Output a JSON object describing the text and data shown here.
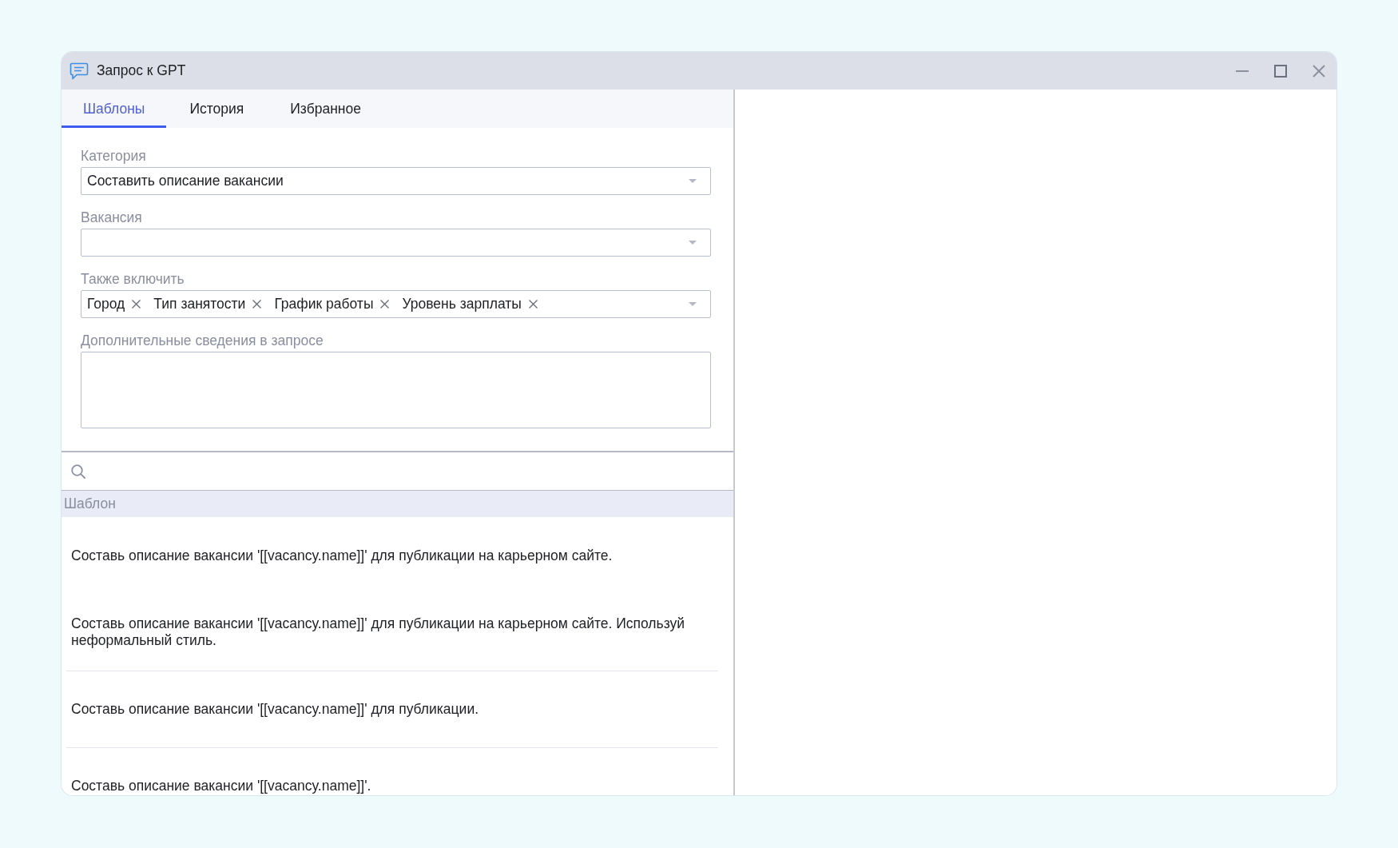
{
  "window": {
    "title": "Запрос к GPT"
  },
  "tabs": [
    {
      "label": "Шаблоны",
      "selected": true
    },
    {
      "label": "История",
      "selected": false
    },
    {
      "label": "Избранное",
      "selected": false
    }
  ],
  "form": {
    "fields": [
      {
        "kind": "select",
        "label": "Категория",
        "value": "Составить описание вакансии"
      },
      {
        "kind": "select",
        "label": "Вакансия"
      },
      {
        "kind": "tags",
        "label": "Также включить",
        "chips": [
          "Город",
          "Тип занятости",
          "График работы",
          "Уровень зарплаты"
        ]
      },
      {
        "kind": "textarea",
        "label": "Дополнительные сведения в запросе"
      }
    ]
  },
  "templates": {
    "column": "Шаблон",
    "rows": [
      "Составь описание вакансии '[[vacancy.name]]' для публикации на карьерном сайте.",
      "Составь описание вакансии '[[vacancy.name]]' для публикации на карьерном сайте. Используй неформальный стиль.",
      "Составь описание вакансии '[[vacancy.name]]' для публикации.",
      "Составь описание вакансии '[[vacancy.name]]'."
    ]
  }
}
